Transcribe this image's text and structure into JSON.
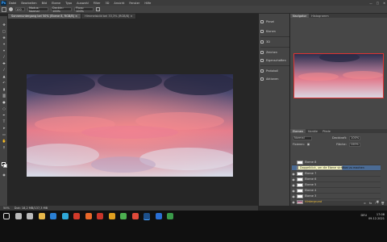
{
  "app": {
    "logo": "Ps",
    "menu": [
      "Datei",
      "Bearbeiten",
      "Bild",
      "Ebene",
      "Typo",
      "Auswahl",
      "Filter",
      "3D",
      "Ansicht",
      "Fenster",
      "Hilfe"
    ]
  },
  "options": {
    "size_field": "100",
    "fields": [
      "Modus: Normal",
      "Deckkr.: 100%",
      "Fluss: 100%"
    ]
  },
  "tabs": [
    {
      "label": "Sonnenuntergang bei 50% (Ebene 8, RGB/8)",
      "active": true
    },
    {
      "label": "Himmelsbild bei 33,3% (RGB/8)",
      "active": false
    }
  ],
  "tools": [
    "move",
    "marquee",
    "lasso",
    "wand",
    "crop",
    "eyedropper",
    "heal",
    "brush",
    "stamp",
    "history",
    "eraser",
    "gradient",
    "blur",
    "dodge",
    "pen",
    "type",
    "path",
    "shape",
    "hand",
    "zoom"
  ],
  "status": {
    "zoom": "50%",
    "doc": "Dok: 18,2 MB/137,3 MB"
  },
  "mid_panel": {
    "items": [
      "Pinsel",
      "Klonen",
      "3D",
      "Zeichen",
      "Eigenschaften",
      "Protokoll",
      "Aktionen"
    ]
  },
  "navigator": {
    "tabs": [
      "Navigator",
      "Histogramm"
    ]
  },
  "layers_panel": {
    "tabs": [
      "Ebenen",
      "Kanäle",
      "Pfade"
    ],
    "blend_mode": "Normal",
    "opacity_label": "Deckkraft:",
    "opacity": "100%",
    "fill_label": "Fläche:",
    "fill": "100%",
    "lock_label": "Fixieren:",
    "layers": [
      {
        "name": "Ebene 8",
        "selected": false,
        "bg": false
      },
      {
        "name": "Ebene 8",
        "selected": true,
        "bg": false
      },
      {
        "name": "Ebene 7",
        "selected": false,
        "bg": false
      },
      {
        "name": "Ebene 6",
        "selected": false,
        "bg": false
      },
      {
        "name": "Ebene 5",
        "selected": false,
        "bg": false
      },
      {
        "name": "Ebene 4",
        "selected": false,
        "bg": false
      },
      {
        "name": "Ebene 3",
        "selected": false,
        "bg": false
      },
      {
        "name": "Hintergrund",
        "selected": false,
        "bg": true
      }
    ],
    "tooltip": "Doppelklick, um die Ebene sichtbar zu machen"
  },
  "taskbar": {
    "time": "17:08",
    "date": "09.12.2021",
    "lang": "DEU",
    "icons": [
      {
        "name": "windows-icon",
        "color": "#dddddd"
      },
      {
        "name": "search-icon",
        "color": "#bbbbbb"
      },
      {
        "name": "task-view-icon",
        "color": "#bbbbbb"
      },
      {
        "name": "explorer-icon",
        "color": "#e8b84a"
      },
      {
        "name": "mail-icon",
        "color": "#2a7fd4"
      },
      {
        "name": "edge-icon",
        "color": "#2fa8d8"
      },
      {
        "name": "media-icon",
        "color": "#d23a2a"
      },
      {
        "name": "firefox-icon",
        "color": "#e8682a"
      },
      {
        "name": "app-icon-1",
        "color": "#c9352a"
      },
      {
        "name": "app-icon-2",
        "color": "#e0a020"
      },
      {
        "name": "chrome-icon",
        "color": "#4caf50"
      },
      {
        "name": "app-icon-3",
        "color": "#e04a3a"
      },
      {
        "name": "photoshop-icon",
        "color": "#1c4f8a"
      },
      {
        "name": "app-icon-4",
        "color": "#2a6fd4"
      },
      {
        "name": "app-icon-5",
        "color": "#3a9a4a"
      }
    ]
  },
  "colors": {
    "accent_red": "#d33333",
    "selected_layer": "#4b6b94"
  }
}
